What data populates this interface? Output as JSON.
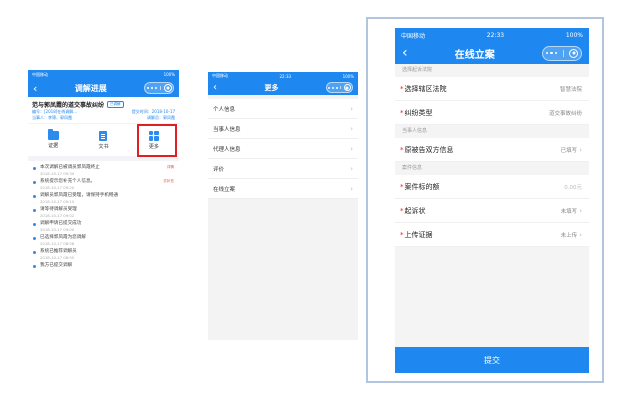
{
  "colors": {
    "brand_blue": "#1f88f0",
    "highlight_red": "#e02020",
    "frame_border": "#b3c4df"
  },
  "phone1": {
    "status": {
      "carrier": "中国移动",
      "battery": "100%"
    },
    "title": "调解进展",
    "case_title": "范与郭凤霞的道交事故纠纷",
    "case_tag": "已调解",
    "meta_line1_left": "编号：[2018]在线调解…",
    "meta_line1_right": "提交时间：2018-10-17",
    "meta_line2_left": "当事人：李锦、郭凤霞",
    "meta_line2_right": "调解员：郭凤霞",
    "functions": [
      {
        "label": "证据",
        "icon": "folder-icon"
      },
      {
        "label": "文书",
        "icon": "document-icon"
      },
      {
        "label": "更多",
        "icon": "grid-icon"
      }
    ],
    "timeline": [
      {
        "title": "本次调解已被调员郭凤霞终止",
        "time": "2018-10-17 09:30",
        "badge": "详情"
      },
      {
        "title": "系统提示您补充个人信息。",
        "time": "2018-10-17 09:20",
        "badge": "去补充"
      },
      {
        "title": "调解员郭凤霞已受理，请保持手机畅通",
        "time": "2018-10-17 09:10",
        "badge": ""
      },
      {
        "title": "请等待调解员受理",
        "time": "2018-10-17 09:02",
        "badge": ""
      },
      {
        "title": "调解申请已提交成功",
        "time": "2018-10-17 09:00",
        "badge": ""
      },
      {
        "title": "已选择郭凤霞为您调解",
        "time": "2018-10-17 08:58",
        "badge": ""
      },
      {
        "title": "系统已推荐调解员",
        "time": "2018-10-17 08:55",
        "badge": ""
      },
      {
        "title": "我方已提交调解",
        "time": "",
        "badge": ""
      }
    ]
  },
  "phone2": {
    "status": {
      "carrier": "中国移动",
      "time": "22:33",
      "battery": "100%"
    },
    "title": "更多",
    "menu": [
      "个人信息",
      "当事人信息",
      "代理人信息",
      "评价",
      "在线立案"
    ]
  },
  "phone3": {
    "status": {
      "carrier": "中国移动",
      "time": "22:33",
      "battery": "100%"
    },
    "title": "在线立案",
    "section1": "选择起诉法院",
    "court_label": "选择辖区法院",
    "court_value": "智慧法院",
    "dispute_label": "纠纷类型",
    "dispute_value": "道交事故纠纷",
    "section2": "当事人信息",
    "parties_label": "原被告双方信息",
    "parties_value": "已填写",
    "section3": "案件信息",
    "amount_label": "案件标的额",
    "amount_value": "0.00元",
    "complaint_label": "起诉状",
    "complaint_value": "未填写",
    "evidence_label": "上传证据",
    "evidence_value": "未上传",
    "submit_label": "提交"
  }
}
